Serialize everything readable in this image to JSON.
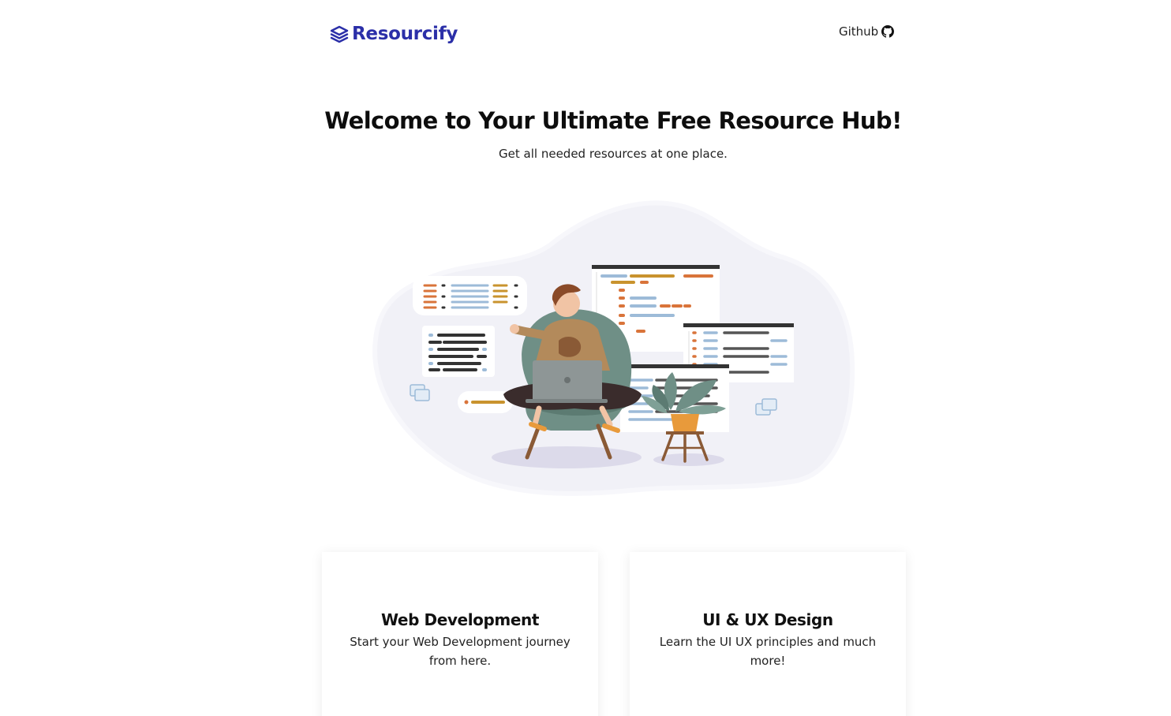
{
  "header": {
    "brand": "Resourcify",
    "github_label": "Github"
  },
  "hero": {
    "title": "Welcome to Your Ultimate Free Resource Hub!",
    "subtitle": "Get all needed resources at one place."
  },
  "cards": [
    {
      "title": "Web Development",
      "description": "Start your Web Development journey from here."
    },
    {
      "title": "UI & UX Design",
      "description": "Learn the UI UX principles and much more!"
    }
  ],
  "colors": {
    "brand": "#2b2fa8",
    "text": "#111111",
    "blob": "#f1f1f7",
    "chair": "#6f8f86",
    "shirt": "#b38a5b",
    "accent_orange": "#d9743a",
    "accent_gold": "#c9932e",
    "accent_blue": "#9dbbd8"
  },
  "icons": {
    "logo": "stacked-layers-icon",
    "github": "github-icon"
  }
}
